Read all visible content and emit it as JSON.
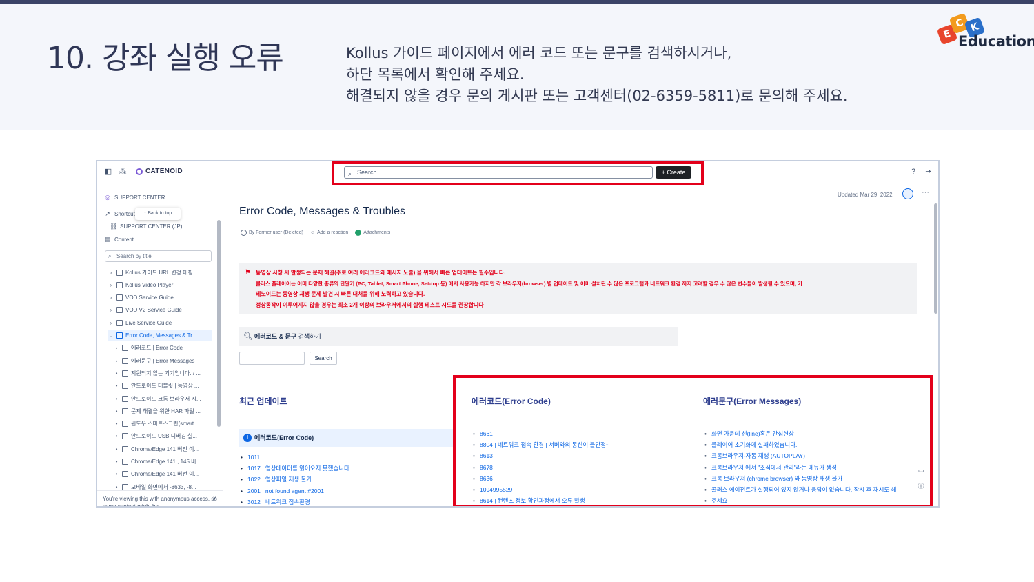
{
  "slide": {
    "title": "10. 강좌 실행 오류",
    "instructions": [
      "Kollus 가이드 페이지에서 에러 코드 또는 문구를 검색하시거나,",
      "하단 목록에서 확인해 주세요.",
      "해결되지 않을 경우 문의 게시판 또는 고객센터(02-6359-5811)로 문의해 주세요."
    ],
    "logo": {
      "letters": [
        "E",
        "C",
        "K"
      ],
      "text": "Education"
    },
    "highlight_color": "#e3001b"
  },
  "app": {
    "brand": "CATENOID",
    "search_placeholder": "Search",
    "create_label": "+ Create",
    "icons": [
      "sidebar-toggle-icon",
      "apps-grid-icon",
      "help-icon",
      "sign-in-icon"
    ]
  },
  "sidebar": {
    "space_name": "SUPPORT CENTER",
    "shortcuts_label": "Shortcuts",
    "back_to_top": "↑ Back to top",
    "jp_link": "SUPPORT CENTER (JP)",
    "content_label": "Content",
    "search_placeholder": "Search by title",
    "tree": [
      {
        "label": "Kollus 가이드 URL 변경 매핑 ...",
        "toggle": "›",
        "level": 0
      },
      {
        "label": "Kollus Video Player",
        "toggle": "›",
        "level": 0
      },
      {
        "label": "VOD Service Guide",
        "toggle": "›",
        "level": 0
      },
      {
        "label": "VOD V2 Service Guide",
        "toggle": "›",
        "level": 0
      },
      {
        "label": "Live Service Guide",
        "toggle": "›",
        "level": 0
      },
      {
        "label": "Error Code, Messages & Tr...",
        "toggle": "⌄",
        "level": 0,
        "active": true
      },
      {
        "label": "에러코드 | Error Code",
        "toggle": "›",
        "level": 1
      },
      {
        "label": "에러문구 | Error Messages",
        "toggle": "›",
        "level": 1
      },
      {
        "label": "지원되지 않는 기기입니다. / ...",
        "toggle": "•",
        "level": 1
      },
      {
        "label": "안드로이드 태블릿 | 동영상 ...",
        "toggle": "•",
        "level": 1
      },
      {
        "label": "안드로이드 크롬 브라우저 시...",
        "toggle": "•",
        "level": 1
      },
      {
        "label": "문제 해결을 위한 HAR 파일 ...",
        "toggle": "•",
        "level": 1
      },
      {
        "label": "윈도우 스마트스크린(smart ...",
        "toggle": "•",
        "level": 1
      },
      {
        "label": "안드로이드 USB 디버깅 설...",
        "toggle": "•",
        "level": 1
      },
      {
        "label": "Chrome/Edge 141 버전 이...",
        "toggle": "•",
        "level": 1
      },
      {
        "label": "Chrome/Edge 141 , 145 버...",
        "toggle": "•",
        "level": 1
      },
      {
        "label": "Chrome/Edge 141 버전 이...",
        "toggle": "•",
        "level": 1
      },
      {
        "label": "모바일 화면에서 -8633, -8...",
        "toggle": "•",
        "level": 1
      }
    ],
    "anon_notice": "You're viewing this with anonymous access, so some content might be"
  },
  "page": {
    "updated": "Updated Mar 29, 2022",
    "title": "Error Code, Messages & Troubles",
    "byline": {
      "author": "By Former user (Deleted)",
      "reaction": "Add a reaction",
      "attachments": "Attachments"
    },
    "notice_lines": [
      "동영상 시청 시 발생되는 문제 해결(주로 여러 에러코드와 메시지 노출) 을 위해서 빠른 업데이트는 필수입니다.",
      "콜러스 플레이어는 이미 다양한 종류의 단말기 (PC, Tablet, Smart Phone, Set-top 등) 에서 사용가능 하지만 각 브라우저(browser) 별 업데이트 및 이미 설치된 수 많은 프로그램과 네트워크 환경 까지 고려할 경우 수 많은 변수들이 발생될 수 있으며, 카",
      "테노이드는 동영상 재생 문제 발견 시 빠른 대처를 위해 노력하고 있습니다.",
      "정상동작이 이루어지지 않을 경우는 최소 2개 이상의 브라우저에서의 실행 테스트 시도를 권장합니다"
    ],
    "search_section": {
      "bold": "에러코드 & 문구",
      "rest": " 검색하기"
    },
    "search_button": "Search",
    "recent": {
      "heading": "최근 업데이트",
      "sub_heading": "에러코드(Error Code)",
      "items": [
        "1011",
        "1017 | 영상데이터를 읽어오지 못했습니다",
        "1022 | 영상파일 재생 불가",
        "2001 | not found agent #2001",
        "3012 | 네트워크 접속환경"
      ]
    },
    "error_codes": {
      "heading": "에러코드(Error Code)",
      "items": [
        "8661",
        "8804 | 네트워크 접속 환경 | 서버와의 통신이 불안정~",
        "8613",
        "8678",
        "8636",
        "1094995529",
        "8614 | 컨텐츠 정보 확인과정에서 오류 발생"
      ]
    },
    "error_messages": {
      "heading": "에러문구(Error Messages)",
      "items": [
        "화면 가운데 선(line)혹은 간섭현상",
        "플레이어 초기화에 실패하였습니다.",
        "크롬브라우저-자동 재생 (AUTOPLAY)",
        "크롬브라우저 에서 \"조직에서 관리\"라는 메뉴가 생성",
        "크롬 브라우저 (chrome browser) 와 동영상 재생 불가",
        "콜러스 에이전트가 실행되어 있지 않거나 응답이 없습니다. 잠시 후 재시도 해",
        "주세요"
      ]
    }
  }
}
